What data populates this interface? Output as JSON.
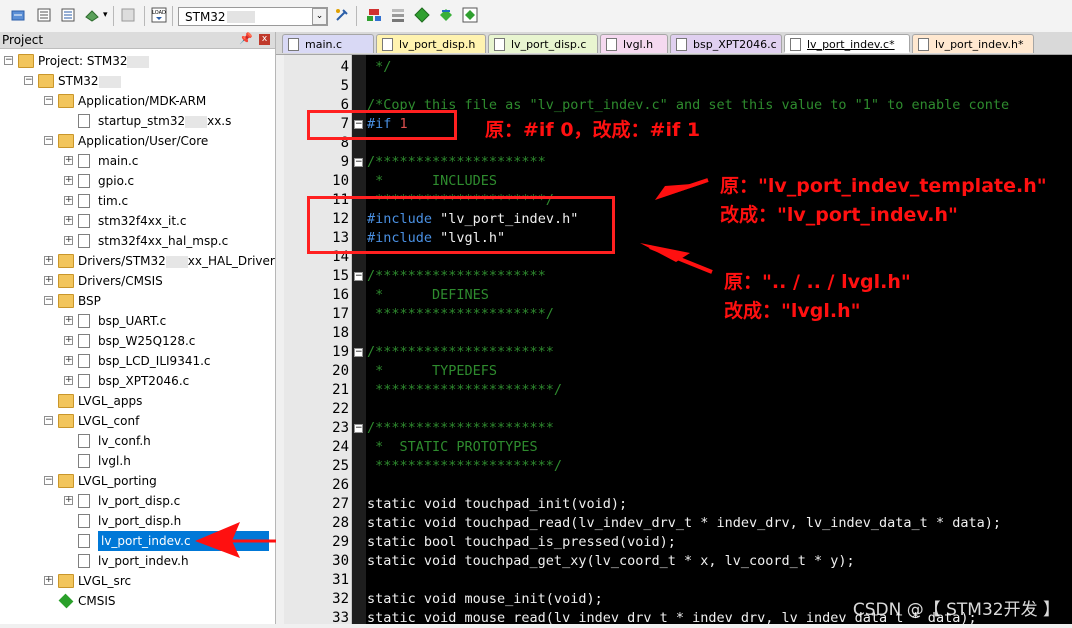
{
  "toolbar": {
    "target_name": "STM32",
    "icons": [
      "build-icon",
      "rebuild-icon",
      "batch-build-icon",
      "translate-icon",
      "stop-build-icon",
      "load-icon",
      "target-options-icon",
      "manage-icon",
      "select-packs-icon",
      "pack-installer-icon",
      "run-icon"
    ]
  },
  "project_panel": {
    "title": "Project",
    "pin_glyph": " Ὕ7",
    "close_glyph": "x",
    "tree": [
      {
        "label": "Project: STM32",
        "level": 0,
        "kind": "project"
      },
      {
        "label": "STM32",
        "level": 1,
        "kind": "target"
      },
      {
        "label": "Application/MDK-ARM",
        "level": 2,
        "kind": "folder"
      },
      {
        "label": "startup_stm32",
        "label_suffix": "xx.s",
        "level": 3,
        "kind": "file"
      },
      {
        "label": "Application/User/Core",
        "level": 2,
        "kind": "folder"
      },
      {
        "label": "main.c",
        "level": 3,
        "kind": "file"
      },
      {
        "label": "gpio.c",
        "level": 3,
        "kind": "file"
      },
      {
        "label": "tim.c",
        "level": 3,
        "kind": "file"
      },
      {
        "label": "stm32f4xx_it.c",
        "level": 3,
        "kind": "file"
      },
      {
        "label": "stm32f4xx_hal_msp.c",
        "level": 3,
        "kind": "file"
      },
      {
        "label": "Drivers/STM32",
        "label_suffix": "xx_HAL_Driver",
        "level": 2,
        "kind": "folder"
      },
      {
        "label": "Drivers/CMSIS",
        "level": 2,
        "kind": "folder"
      },
      {
        "label": "BSP",
        "level": 2,
        "kind": "folder"
      },
      {
        "label": "bsp_UART.c",
        "level": 3,
        "kind": "file"
      },
      {
        "label": "bsp_W25Q128.c",
        "level": 3,
        "kind": "file"
      },
      {
        "label": "bsp_LCD_ILI9341.c",
        "level": 3,
        "kind": "file"
      },
      {
        "label": "bsp_XPT2046.c",
        "level": 3,
        "kind": "file"
      },
      {
        "label": "LVGL_apps",
        "level": 2,
        "kind": "folder"
      },
      {
        "label": "LVGL_conf",
        "level": 2,
        "kind": "folder"
      },
      {
        "label": "lv_conf.h",
        "level": 3,
        "kind": "file"
      },
      {
        "label": "lvgl.h",
        "level": 3,
        "kind": "file"
      },
      {
        "label": "LVGL_porting",
        "level": 2,
        "kind": "folder"
      },
      {
        "label": "lv_port_disp.c",
        "level": 3,
        "kind": "file"
      },
      {
        "label": "lv_port_disp.h",
        "level": 3,
        "kind": "file"
      },
      {
        "label": "lv_port_indev.c",
        "level": 3,
        "kind": "file",
        "selected": true
      },
      {
        "label": "lv_port_indev.h",
        "level": 3,
        "kind": "file"
      },
      {
        "label": "LVGL_src",
        "level": 2,
        "kind": "folder"
      },
      {
        "label": "CMSIS",
        "level": 2,
        "kind": "component"
      }
    ]
  },
  "tabs": [
    {
      "label": "main.c",
      "color": "#d9d9f5"
    },
    {
      "label": "lv_port_disp.h",
      "color": "#fff3b0"
    },
    {
      "label": "lv_port_disp.c",
      "color": "#e8f5d0"
    },
    {
      "label": "lvgl.h",
      "color": "#f5d9f0"
    },
    {
      "label": "bsp_XPT2046.c",
      "color": "#e0d0f0"
    },
    {
      "label": "lv_port_indev.c*",
      "color": "#ffffff",
      "active": true
    },
    {
      "label": "lv_port_indev.h*",
      "color": "#ffe8d0"
    }
  ],
  "editor": {
    "lines": [
      {
        "n": "4",
        "fold": "",
        "tokens": [
          {
            "t": " */",
            "c": "comment"
          }
        ]
      },
      {
        "n": "5",
        "fold": "",
        "tokens": []
      },
      {
        "n": "6",
        "fold": "",
        "tokens": [
          {
            "t": "/*Copy this file as \"lv_port_indev.c\" and set this value to \"1\" to enable conte",
            "c": "comment"
          }
        ]
      },
      {
        "n": "7",
        "fold": "−",
        "tokens": [
          {
            "t": "#if ",
            "c": "pp"
          },
          {
            "t": "1",
            "c": "num"
          }
        ]
      },
      {
        "n": "8",
        "fold": "",
        "tokens": []
      },
      {
        "n": "9",
        "fold": "−",
        "tokens": [
          {
            "t": "/*********************",
            "c": "comment"
          }
        ]
      },
      {
        "n": "10",
        "fold": "",
        "tokens": [
          {
            "t": " *      INCLUDES",
            "c": "comment"
          }
        ]
      },
      {
        "n": "11",
        "fold": "",
        "tokens": [
          {
            "t": " *********************/",
            "c": "comment"
          }
        ]
      },
      {
        "n": "12",
        "fold": "",
        "tokens": [
          {
            "t": "#include ",
            "c": "pp"
          },
          {
            "t": "\"lv_port_indev.h\"",
            "c": "str"
          }
        ]
      },
      {
        "n": "13",
        "fold": "",
        "tokens": [
          {
            "t": "#include ",
            "c": "pp"
          },
          {
            "t": "\"lvgl.h\"",
            "c": "str"
          }
        ]
      },
      {
        "n": "14",
        "fold": "",
        "tokens": []
      },
      {
        "n": "15",
        "fold": "−",
        "tokens": [
          {
            "t": "/*********************",
            "c": "comment"
          }
        ]
      },
      {
        "n": "16",
        "fold": "",
        "tokens": [
          {
            "t": " *      DEFINES",
            "c": "comment"
          }
        ]
      },
      {
        "n": "17",
        "fold": "",
        "tokens": [
          {
            "t": " *********************/",
            "c": "comment"
          }
        ]
      },
      {
        "n": "18",
        "fold": "",
        "tokens": []
      },
      {
        "n": "19",
        "fold": "−",
        "tokens": [
          {
            "t": "/**********************",
            "c": "comment"
          }
        ]
      },
      {
        "n": "20",
        "fold": "",
        "tokens": [
          {
            "t": " *      TYPEDEFS",
            "c": "comment"
          }
        ]
      },
      {
        "n": "21",
        "fold": "",
        "tokens": [
          {
            "t": " **********************/",
            "c": "comment"
          }
        ]
      },
      {
        "n": "22",
        "fold": "",
        "tokens": []
      },
      {
        "n": "23",
        "fold": "−",
        "tokens": [
          {
            "t": "/**********************",
            "c": "comment"
          }
        ]
      },
      {
        "n": "24",
        "fold": "",
        "tokens": [
          {
            "t": " *  STATIC PROTOTYPES",
            "c": "comment"
          }
        ]
      },
      {
        "n": "25",
        "fold": "",
        "tokens": [
          {
            "t": " **********************/",
            "c": "comment"
          }
        ]
      },
      {
        "n": "26",
        "fold": "",
        "tokens": []
      },
      {
        "n": "27",
        "fold": "",
        "tokens": [
          {
            "t": "static void touchpad_init(void);",
            "c": "plain"
          }
        ]
      },
      {
        "n": "28",
        "fold": "",
        "tokens": [
          {
            "t": "static void touchpad_read(lv_indev_drv_t * indev_drv, lv_indev_data_t * data);",
            "c": "plain"
          }
        ]
      },
      {
        "n": "29",
        "fold": "",
        "tokens": [
          {
            "t": "static bool touchpad_is_pressed(void);",
            "c": "plain"
          }
        ]
      },
      {
        "n": "30",
        "fold": "",
        "tokens": [
          {
            "t": "static void touchpad_get_xy(lv_coord_t * x, lv_coord_t * y);",
            "c": "plain"
          }
        ]
      },
      {
        "n": "31",
        "fold": "",
        "tokens": []
      },
      {
        "n": "32",
        "fold": "",
        "tokens": [
          {
            "t": "static void mouse_init(void);",
            "c": "plain"
          }
        ]
      },
      {
        "n": "33",
        "fold": "",
        "tokens": [
          {
            "t": "static void mouse_read(lv_indev_drv_t * indev_drv, lv_indev_data_t * data);",
            "c": "plain"
          }
        ]
      }
    ]
  },
  "annotations": {
    "note1": "原：#if 0，改成：#if 1",
    "note2_line1": "原：\"lv_port_indev_template.h\"",
    "note2_line2": "改成：\"lv_port_indev.h\"",
    "note3_line1": "原：\".. / .. / lvgl.h\"",
    "note3_line2": "改成：\"lvgl.h\"",
    "color": "#ff1010"
  },
  "watermark": "CSDN @【 STM32开发 】"
}
